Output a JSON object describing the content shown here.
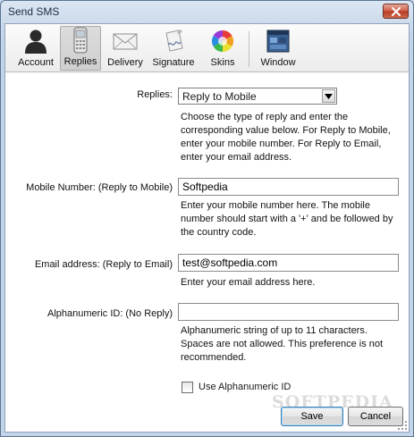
{
  "window": {
    "title": "Send SMS"
  },
  "toolbar": {
    "items": [
      {
        "label": "Account",
        "icon": "person-icon"
      },
      {
        "label": "Replies",
        "icon": "phone-icon"
      },
      {
        "label": "Delivery",
        "icon": "envelope-icon"
      },
      {
        "label": "Signature",
        "icon": "signature-icon"
      },
      {
        "label": "Skins",
        "icon": "color-wheel-icon"
      },
      {
        "label": "Window",
        "icon": "window-icon"
      }
    ],
    "active": "Replies"
  },
  "form": {
    "replies": {
      "label": "Replies:",
      "selected": "Reply to Mobile",
      "help": "Choose the type of reply and enter the corresponding value below. For Reply to Mobile, enter your mobile number. For Reply to Email, enter your email address."
    },
    "mobile": {
      "label": "Mobile Number: (Reply to Mobile)",
      "value": "Softpedia",
      "help": "Enter your mobile number here. The mobile number should start with a '+' and be followed by the country code."
    },
    "email": {
      "label": "Email address: (Reply to Email)",
      "value": "test@softpedia.com",
      "help": "Enter your email address here."
    },
    "alphanumeric": {
      "label": "Alphanumeric ID: (No Reply)",
      "value": "",
      "help": "Alphanumeric string of up to 11 characters. Spaces are not allowed. This preference is not recommended."
    },
    "use_alphanumeric": {
      "label": "Use Alphanumeric ID",
      "checked": false
    }
  },
  "buttons": {
    "save": "Save",
    "cancel": "Cancel"
  },
  "watermark": "SOFTPEDIA"
}
